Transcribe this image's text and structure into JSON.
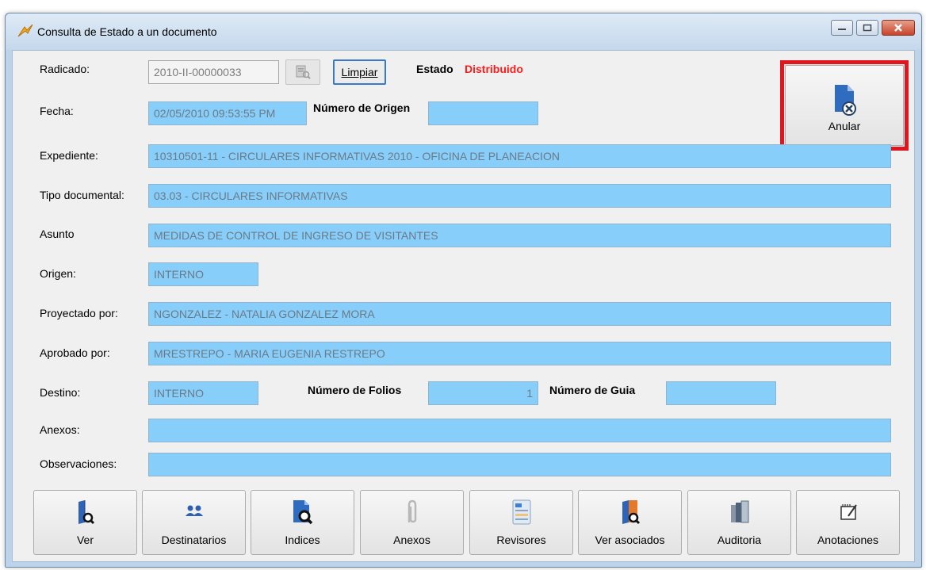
{
  "window": {
    "title": "Consulta de Estado a un documento"
  },
  "form": {
    "radicado_label": "Radicado:",
    "radicado_value": "2010-II-00000033",
    "limpiar_label": "Limpiar",
    "estado_label": "Estado",
    "estado_value": "Distribuido",
    "fecha_label": "Fecha:",
    "fecha_value": "02/05/2010 09:53:55 PM",
    "numero_origen_label": "Número de Origen",
    "numero_origen_value": "",
    "expediente_label": "Expediente:",
    "expediente_value": "10310501-11 - CIRCULARES INFORMATIVAS 2010 - OFICINA DE PLANEACION",
    "tipo_documental_label": "Tipo documental:",
    "tipo_documental_value": "03.03 - CIRCULARES INFORMATIVAS",
    "asunto_label": "Asunto",
    "asunto_value": "MEDIDAS DE CONTROL DE INGRESO DE VISITANTES",
    "origen_label": "Origen:",
    "origen_value": "INTERNO",
    "proyectado_label": "Proyectado por:",
    "proyectado_value": "NGONZALEZ - NATALIA GONZALEZ MORA",
    "aprobado_label": "Aprobado por:",
    "aprobado_value": "MRESTREPO - MARIA EUGENIA RESTREPO",
    "destino_label": "Destino:",
    "destino_value": "INTERNO",
    "numero_folios_label": "Número de Folios",
    "numero_folios_value": "1",
    "numero_guia_label": "Número de Guia",
    "numero_guia_value": "",
    "anexos_label": "Anexos:",
    "anexos_value": "",
    "observaciones_label": "Observaciones:",
    "observaciones_value": ""
  },
  "anular": {
    "label": "Anular",
    "icon": "document-cancel-icon"
  },
  "toolbar": {
    "buttons": [
      {
        "label": "Ver",
        "icon": "book-search-icon"
      },
      {
        "label": "Destinatarios",
        "icon": "users-icon"
      },
      {
        "label": "Indices",
        "icon": "document-search-icon"
      },
      {
        "label": "Anexos",
        "icon": "paperclip-icon"
      },
      {
        "label": "Revisores",
        "icon": "form-card-icon"
      },
      {
        "label": "Ver asociados",
        "icon": "binder-search-icon"
      },
      {
        "label": "Auditoria",
        "icon": "stacked-books-icon"
      },
      {
        "label": "Anotaciones",
        "icon": "notepad-icon"
      }
    ]
  },
  "colors": {
    "field_bg": "#87cefa",
    "estado_text": "#ff1a1a",
    "highlight_border": "#e0161f"
  }
}
